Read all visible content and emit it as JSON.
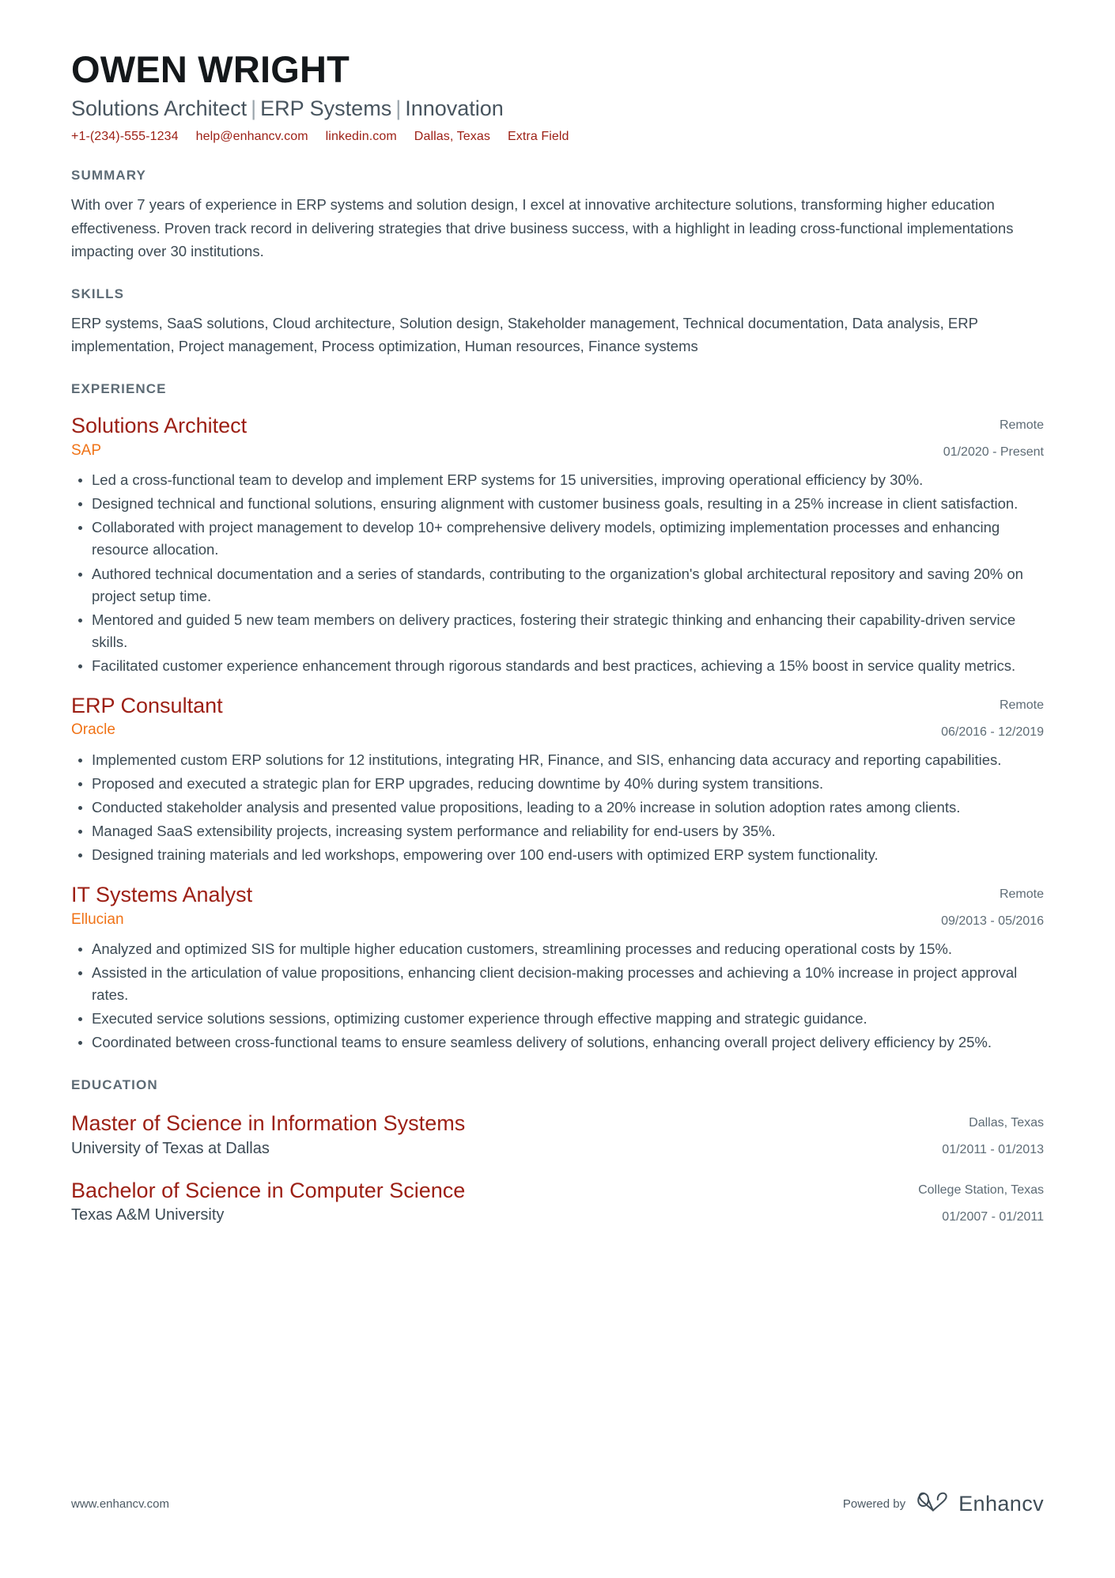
{
  "header": {
    "name": "OWEN WRIGHT",
    "headline_parts": [
      "Solutions Architect",
      "ERP Systems",
      "Innovation"
    ],
    "separator": "|",
    "contacts": [
      {
        "name": "phone",
        "value": "+1-(234)-555-1234"
      },
      {
        "name": "email",
        "value": "help@enhancv.com"
      },
      {
        "name": "linkedin",
        "value": "linkedin.com"
      },
      {
        "name": "location",
        "value": "Dallas, Texas"
      },
      {
        "name": "extra",
        "value": "Extra Field"
      }
    ]
  },
  "summary": {
    "title": "SUMMARY",
    "text": "With over 7 years of experience in ERP systems and solution design, I excel at innovative architecture solutions, transforming higher education effectiveness. Proven track record in delivering strategies that drive business success, with a highlight in leading cross-functional implementations impacting over 30 institutions."
  },
  "skills": {
    "title": "SKILLS",
    "text": "ERP systems, SaaS solutions, Cloud architecture, Solution design, Stakeholder management, Technical documentation, Data analysis, ERP implementation, Project management, Process optimization, Human resources, Finance systems"
  },
  "experience": {
    "title": "EXPERIENCE",
    "entries": [
      {
        "role": "Solutions Architect",
        "company": "SAP",
        "location": "Remote",
        "dates": "01/2020 - Present",
        "bullets": [
          "Led a cross-functional team to develop and implement ERP systems for 15 universities, improving operational efficiency by 30%.",
          "Designed technical and functional solutions, ensuring alignment with customer business goals, resulting in a 25% increase in client satisfaction.",
          "Collaborated with project management to develop 10+ comprehensive delivery models, optimizing implementation processes and enhancing resource allocation.",
          "Authored technical documentation and a series of standards, contributing to the organization's global architectural repository and saving 20% on project setup time.",
          "Mentored and guided 5 new team members on delivery practices, fostering their strategic thinking and enhancing their capability-driven service skills.",
          "Facilitated customer experience enhancement through rigorous standards and best practices, achieving a 15% boost in service quality metrics."
        ]
      },
      {
        "role": "ERP Consultant",
        "company": "Oracle",
        "location": "Remote",
        "dates": "06/2016 - 12/2019",
        "bullets": [
          "Implemented custom ERP solutions for 12 institutions, integrating HR, Finance, and SIS, enhancing data accuracy and reporting capabilities.",
          "Proposed and executed a strategic plan for ERP upgrades, reducing downtime by 40% during system transitions.",
          "Conducted stakeholder analysis and presented value propositions, leading to a 20% increase in solution adoption rates among clients.",
          "Managed SaaS extensibility projects, increasing system performance and reliability for end-users by 35%.",
          "Designed training materials and led workshops, empowering over 100 end-users with optimized ERP system functionality."
        ]
      },
      {
        "role": "IT Systems Analyst",
        "company": "Ellucian",
        "location": "Remote",
        "dates": "09/2013 - 05/2016",
        "bullets": [
          "Analyzed and optimized SIS for multiple higher education customers, streamlining processes and reducing operational costs by 15%.",
          "Assisted in the articulation of value propositions, enhancing client decision-making processes and achieving a 10% increase in project approval rates.",
          "Executed service solutions sessions, optimizing customer experience through effective mapping and strategic guidance.",
          "Coordinated between cross-functional teams to ensure seamless delivery of solutions, enhancing overall project delivery efficiency by 25%."
        ]
      }
    ]
  },
  "education": {
    "title": "EDUCATION",
    "entries": [
      {
        "degree": "Master of Science in Information Systems",
        "school": "University of Texas at Dallas",
        "location": "Dallas, Texas",
        "dates": "01/2011 - 01/2013"
      },
      {
        "degree": "Bachelor of Science in Computer Science",
        "school": "Texas A&M University",
        "location": "College Station, Texas",
        "dates": "01/2007 - 01/2011"
      }
    ]
  },
  "footer": {
    "website": "www.enhancv.com",
    "powered_by": "Powered by",
    "brand": "Enhancv",
    "brand_icon": "enhancv-infinity-logo-icon"
  },
  "colors": {
    "accent_red": "#9c1f14",
    "accent_orange": "#f07317",
    "body_text": "#3c4a54",
    "section_heading": "#5d6b75",
    "name_text": "#14181b"
  }
}
